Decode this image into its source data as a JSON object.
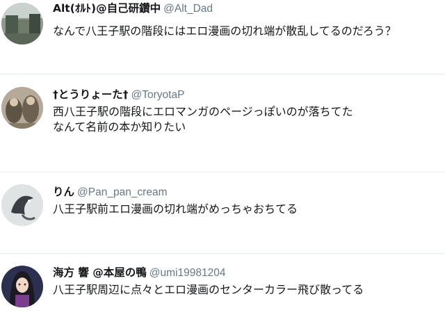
{
  "tweets": [
    {
      "name": "Alt(ｵﾙﾄ)@自己研鑽中",
      "handle": "@Alt_Dad",
      "lines": [
        "なんで八王子駅の階段にはエロ漫画の切れ端が散乱してるのだろう？"
      ]
    },
    {
      "name": "†とうりょーた†",
      "handle": "@ToryotaP",
      "lines": [
        "西八王子駅の階段にエロマンガのページっぽいのが落ちてた",
        "なんて名前の本か知りたい"
      ]
    },
    {
      "name": "りん",
      "handle": "@Pan_pan_cream",
      "lines": [
        "八王子駅前エロ漫画の切れ端がめっちゃおちてる"
      ]
    },
    {
      "name": "海方 響 @本屋の鴨",
      "handle": "@umi19981204",
      "lines": [
        "八王子駅周辺に点々とエロ漫画のセンターカラー飛び散ってる"
      ]
    }
  ],
  "colors": {
    "text": "#14171a",
    "handle": "#657786",
    "divider": "#e6ecf0"
  }
}
